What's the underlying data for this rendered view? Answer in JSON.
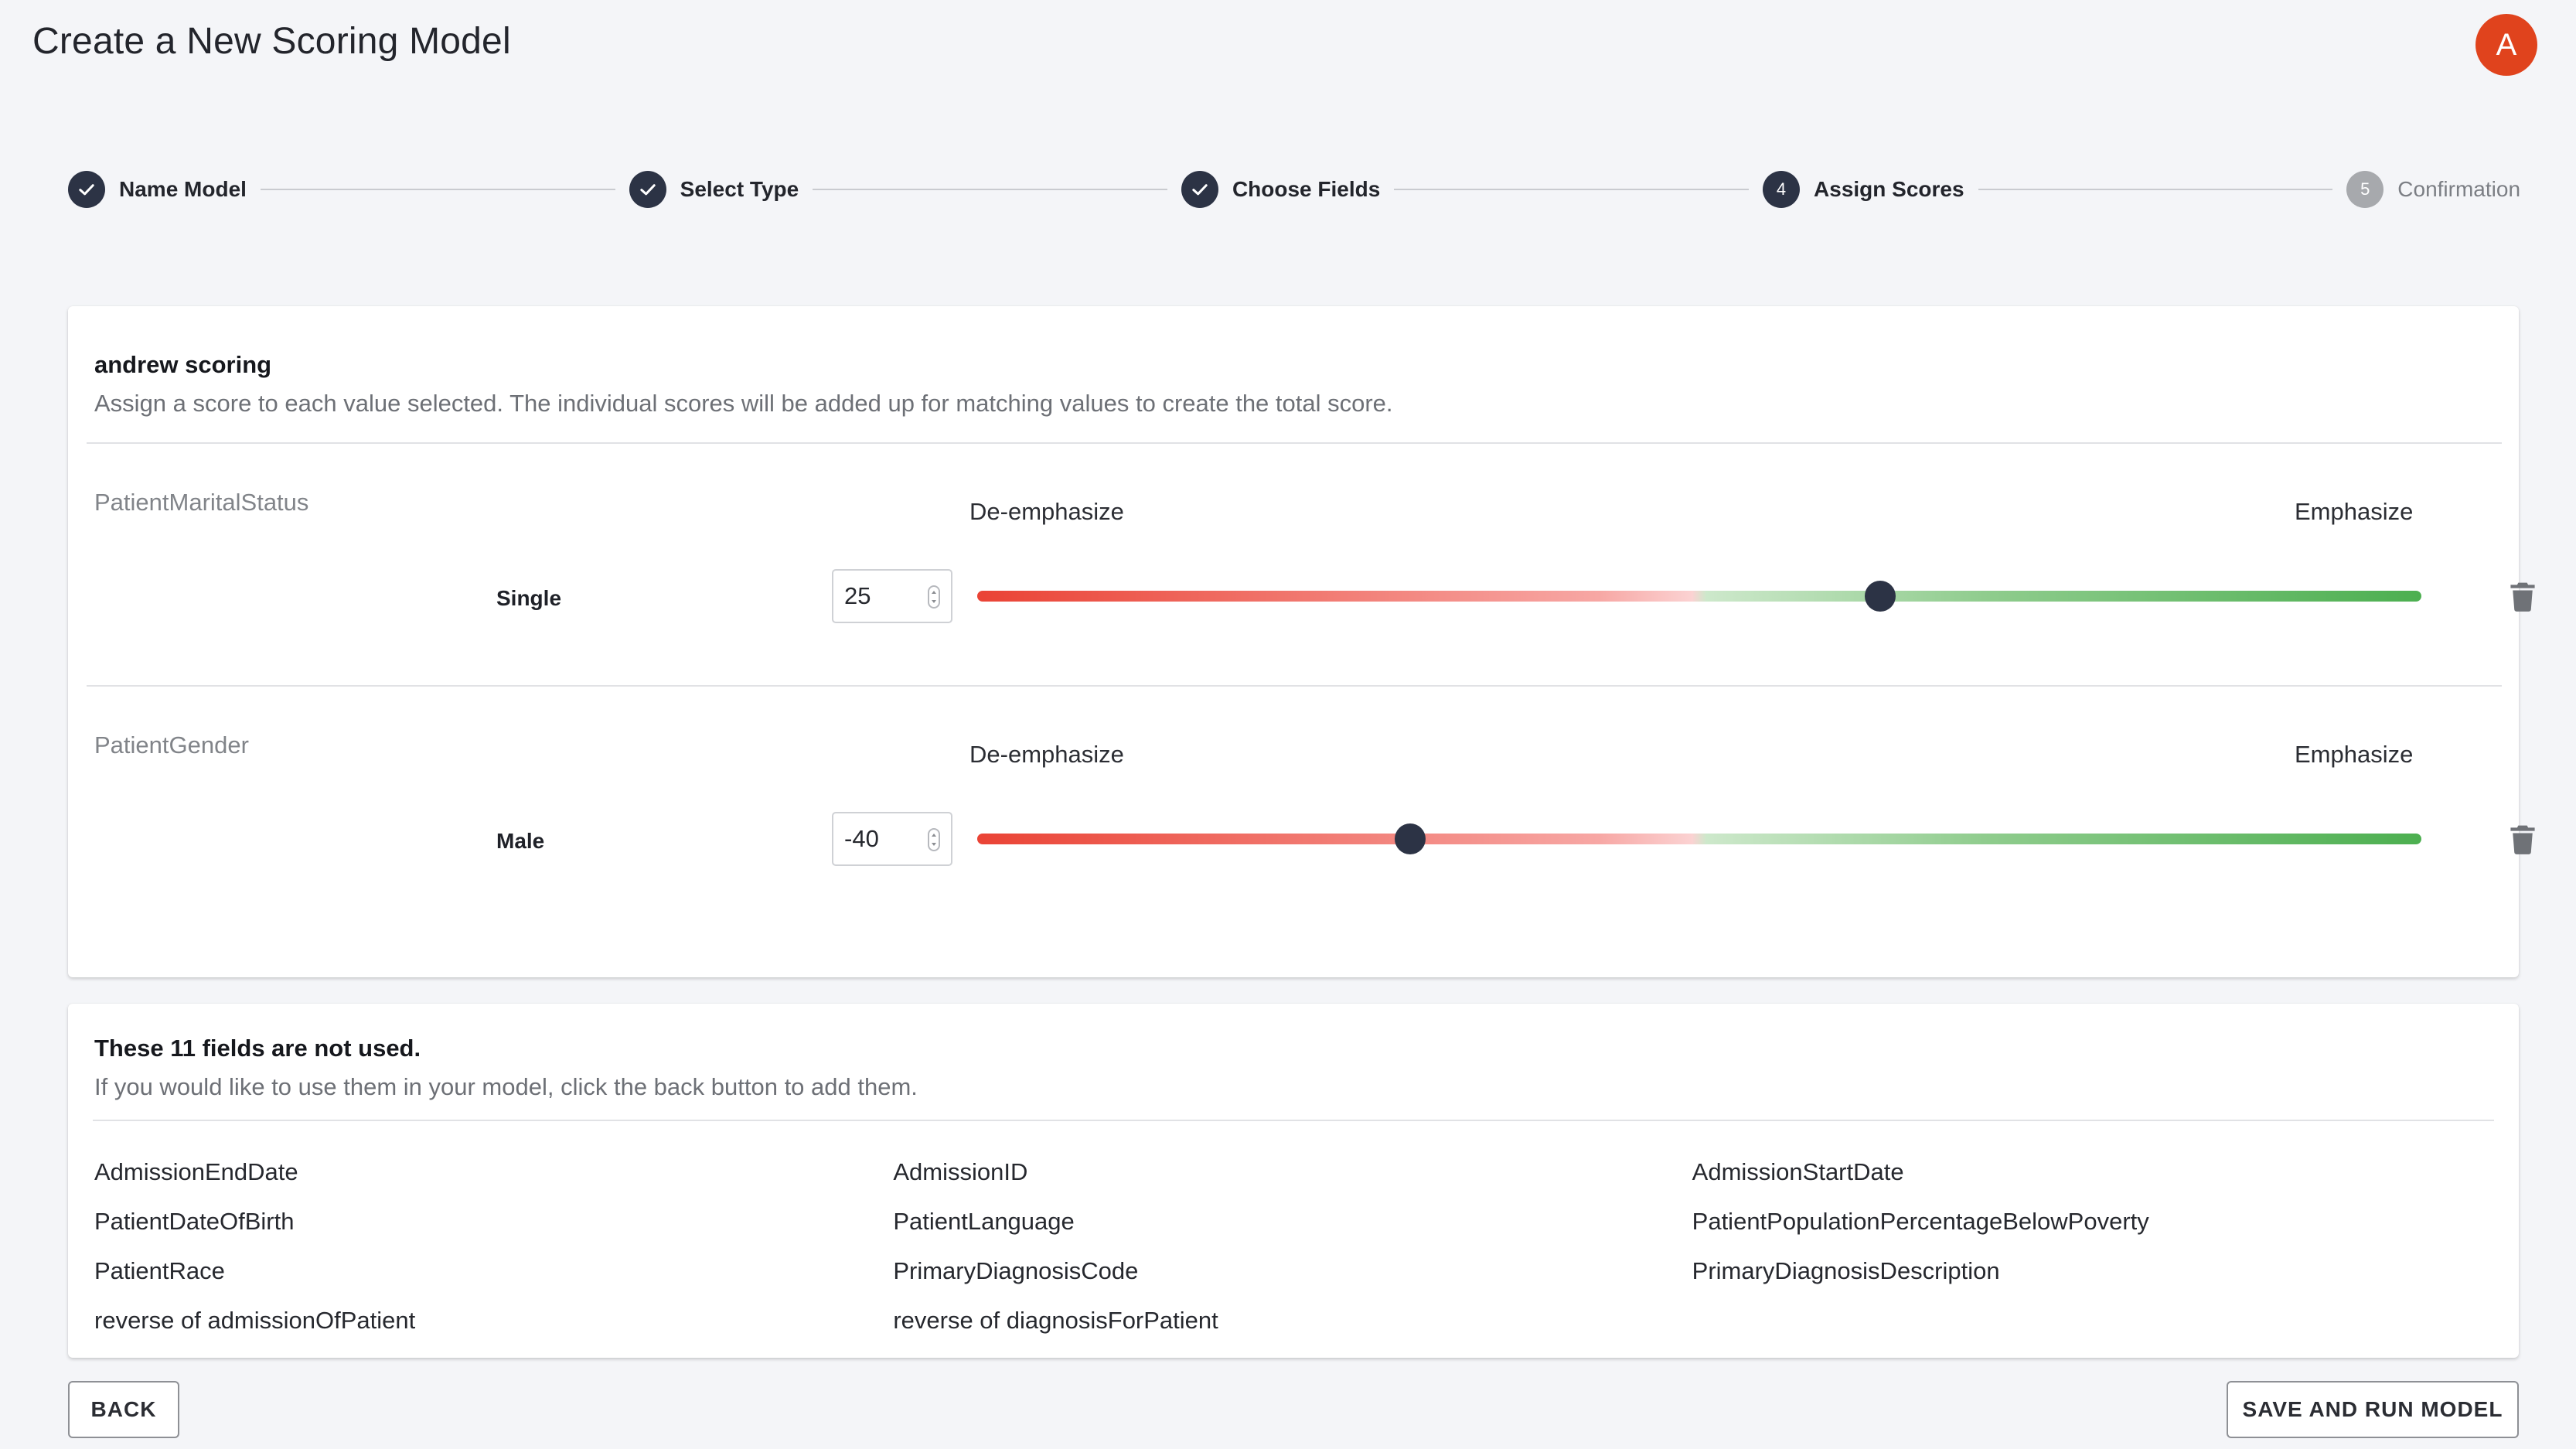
{
  "header": {
    "title": "Create a New Scoring Model",
    "avatar_initial": "A"
  },
  "stepper": {
    "steps": [
      {
        "label": "Name Model",
        "state": "completed",
        "number": "1"
      },
      {
        "label": "Select Type",
        "state": "completed",
        "number": "2"
      },
      {
        "label": "Choose Fields",
        "state": "completed",
        "number": "3"
      },
      {
        "label": "Assign Scores",
        "state": "active",
        "number": "4"
      },
      {
        "label": "Confirmation",
        "state": "pending",
        "number": "5"
      }
    ]
  },
  "scores_card": {
    "model_name": "andrew scoring",
    "description": "Assign a score to each value selected. The individual scores will be added up for matching values to create the total score.",
    "fields": [
      {
        "field_name": "PatientMaritalStatus",
        "deemphasize_label": "De-emphasize",
        "emphasize_label": "Emphasize",
        "value_label": "Single",
        "score": "25",
        "slider_fraction": 0.625
      },
      {
        "field_name": "PatientGender",
        "deemphasize_label": "De-emphasize",
        "emphasize_label": "Emphasize",
        "value_label": "Male",
        "score": "-40",
        "slider_fraction": 0.3
      }
    ]
  },
  "unused_card": {
    "title": "These 11 fields are not used.",
    "description": "If you would like to use them in your model, click the back button to add them.",
    "rows": [
      [
        "AdmissionEndDate",
        "AdmissionID",
        "AdmissionStartDate"
      ],
      [
        "PatientDateOfBirth",
        "PatientLanguage",
        "PatientPopulationPercentageBelowPoverty"
      ],
      [
        "PatientRace",
        "PrimaryDiagnosisCode",
        "PrimaryDiagnosisDescription"
      ],
      [
        "reverse of admissionOfPatient",
        "reverse of diagnosisForPatient",
        ""
      ]
    ]
  },
  "footer": {
    "back_label": "BACK",
    "save_label": "SAVE AND RUN MODEL"
  },
  "colors": {
    "primary_dark": "#2c3345",
    "avatar": "#e0431d",
    "deemphasize_red": "#ea4335",
    "emphasize_green": "#4caf50"
  }
}
